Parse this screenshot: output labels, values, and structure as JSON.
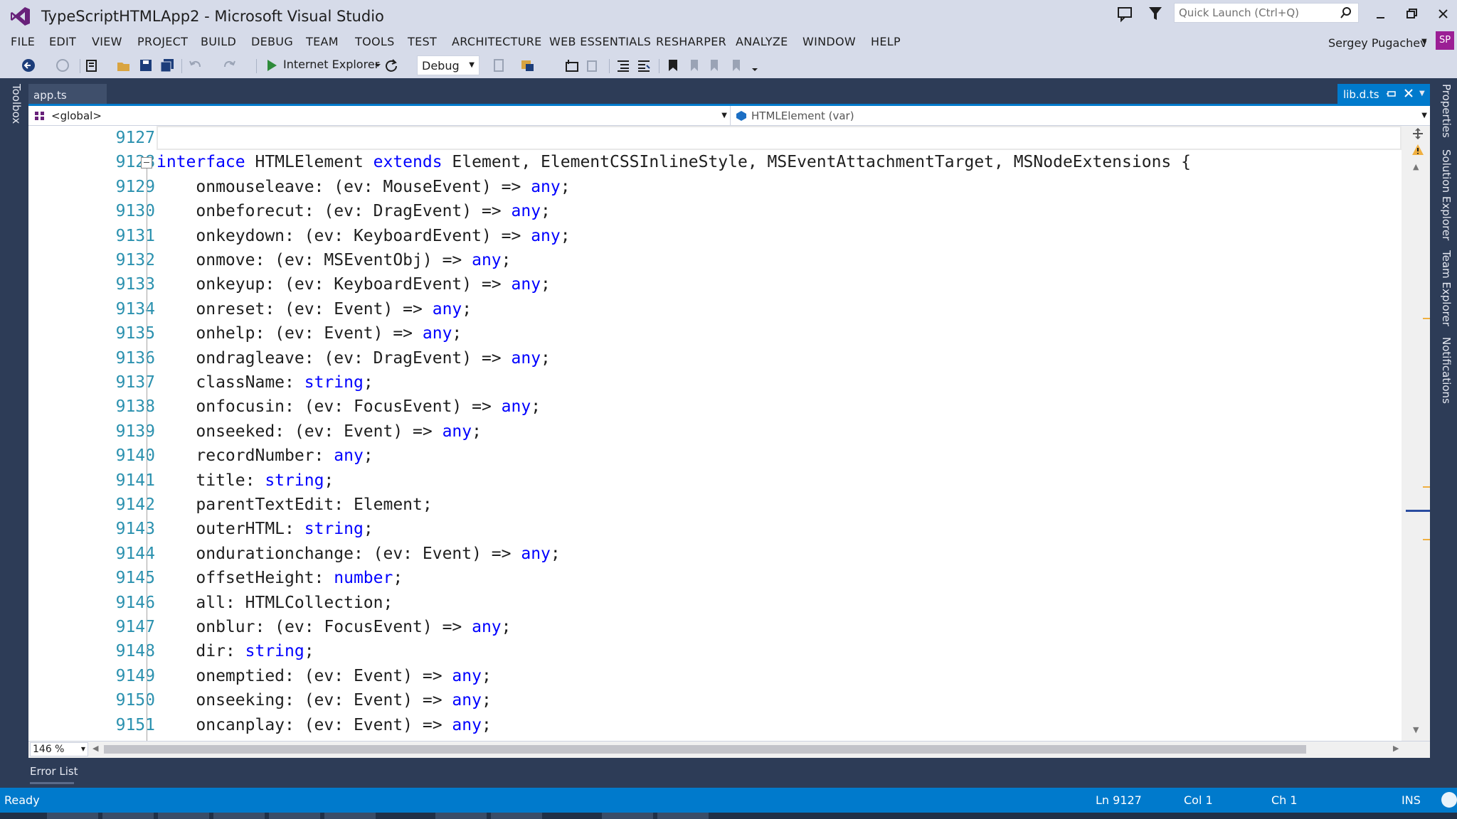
{
  "window": {
    "title": "TypeScriptHTMLApp2 - Microsoft Visual Studio"
  },
  "quick_launch": {
    "placeholder": "Quick Launch (Ctrl+Q)"
  },
  "menu": [
    "FILE",
    "EDIT",
    "VIEW",
    "PROJECT",
    "BUILD",
    "DEBUG",
    "TEAM",
    "TOOLS",
    "TEST",
    "ARCHITECTURE",
    "WEB ESSENTIALS",
    "RESHARPER",
    "ANALYZE",
    "WINDOW",
    "HELP"
  ],
  "user": {
    "name": "Sergey Pugachev",
    "initials": "SP",
    "avatar_color": "#9b1f95"
  },
  "toolbar": {
    "run_target": "Internet Explorer",
    "configuration": "Debug"
  },
  "side_tabs": {
    "left": "Toolbox",
    "right": [
      "Properties",
      "Solution Explorer",
      "Team Explorer",
      "Notifications"
    ]
  },
  "tabs": {
    "left": "app.ts",
    "active": "lib.d.ts"
  },
  "nav": {
    "scope": "<global>",
    "member": "HTMLElement (var)"
  },
  "editor": {
    "zoom": "146 %",
    "lines": [
      {
        "num": "9127",
        "parts": []
      },
      {
        "num": "9128",
        "parts": [
          [
            "kw",
            "interface"
          ],
          [
            "t",
            " HTMLElement "
          ],
          [
            "kw",
            "extends"
          ],
          [
            "t",
            " Element, ElementCSSInlineStyle, MSEventAttachmentTarget, MSNodeExtensions {"
          ]
        ]
      },
      {
        "num": "9129",
        "parts": [
          [
            "t",
            "    onmouseleave: (ev: MouseEvent) => "
          ],
          [
            "kw",
            "any"
          ],
          [
            "t",
            ";"
          ]
        ]
      },
      {
        "num": "9130",
        "parts": [
          [
            "t",
            "    onbeforecut: (ev: DragEvent) => "
          ],
          [
            "kw",
            "any"
          ],
          [
            "t",
            ";"
          ]
        ]
      },
      {
        "num": "9131",
        "parts": [
          [
            "t",
            "    onkeydown: (ev: KeyboardEvent) => "
          ],
          [
            "kw",
            "any"
          ],
          [
            "t",
            ";"
          ]
        ]
      },
      {
        "num": "9132",
        "parts": [
          [
            "t",
            "    onmove: (ev: MSEventObj) => "
          ],
          [
            "kw",
            "any"
          ],
          [
            "t",
            ";"
          ]
        ]
      },
      {
        "num": "9133",
        "parts": [
          [
            "t",
            "    onkeyup: (ev: KeyboardEvent) => "
          ],
          [
            "kw",
            "any"
          ],
          [
            "t",
            ";"
          ]
        ]
      },
      {
        "num": "9134",
        "parts": [
          [
            "t",
            "    onreset: (ev: Event) => "
          ],
          [
            "kw",
            "any"
          ],
          [
            "t",
            ";"
          ]
        ]
      },
      {
        "num": "9135",
        "parts": [
          [
            "t",
            "    onhelp: (ev: Event) => "
          ],
          [
            "kw",
            "any"
          ],
          [
            "t",
            ";"
          ]
        ]
      },
      {
        "num": "9136",
        "parts": [
          [
            "t",
            "    ondragleave: (ev: DragEvent) => "
          ],
          [
            "kw",
            "any"
          ],
          [
            "t",
            ";"
          ]
        ]
      },
      {
        "num": "9137",
        "parts": [
          [
            "t",
            "    className: "
          ],
          [
            "kw",
            "string"
          ],
          [
            "t",
            ";"
          ]
        ]
      },
      {
        "num": "9138",
        "parts": [
          [
            "t",
            "    onfocusin: (ev: FocusEvent) => "
          ],
          [
            "kw",
            "any"
          ],
          [
            "t",
            ";"
          ]
        ]
      },
      {
        "num": "9139",
        "parts": [
          [
            "t",
            "    onseeked: (ev: Event) => "
          ],
          [
            "kw",
            "any"
          ],
          [
            "t",
            ";"
          ]
        ]
      },
      {
        "num": "9140",
        "parts": [
          [
            "t",
            "    recordNumber: "
          ],
          [
            "kw",
            "any"
          ],
          [
            "t",
            ";"
          ]
        ]
      },
      {
        "num": "9141",
        "parts": [
          [
            "t",
            "    title: "
          ],
          [
            "kw",
            "string"
          ],
          [
            "t",
            ";"
          ]
        ]
      },
      {
        "num": "9142",
        "parts": [
          [
            "t",
            "    parentTextEdit: Element;"
          ]
        ]
      },
      {
        "num": "9143",
        "parts": [
          [
            "t",
            "    outerHTML: "
          ],
          [
            "kw",
            "string"
          ],
          [
            "t",
            ";"
          ]
        ]
      },
      {
        "num": "9144",
        "parts": [
          [
            "t",
            "    ondurationchange: (ev: Event) => "
          ],
          [
            "kw",
            "any"
          ],
          [
            "t",
            ";"
          ]
        ]
      },
      {
        "num": "9145",
        "parts": [
          [
            "t",
            "    offsetHeight: "
          ],
          [
            "kw",
            "number"
          ],
          [
            "t",
            ";"
          ]
        ]
      },
      {
        "num": "9146",
        "parts": [
          [
            "t",
            "    all: HTMLCollection;"
          ]
        ]
      },
      {
        "num": "9147",
        "parts": [
          [
            "t",
            "    onblur: (ev: FocusEvent) => "
          ],
          [
            "kw",
            "any"
          ],
          [
            "t",
            ";"
          ]
        ]
      },
      {
        "num": "9148",
        "parts": [
          [
            "t",
            "    dir: "
          ],
          [
            "kw",
            "string"
          ],
          [
            "t",
            ";"
          ]
        ]
      },
      {
        "num": "9149",
        "parts": [
          [
            "t",
            "    onemptied: (ev: Event) => "
          ],
          [
            "kw",
            "any"
          ],
          [
            "t",
            ";"
          ]
        ]
      },
      {
        "num": "9150",
        "parts": [
          [
            "t",
            "    onseeking: (ev: Event) => "
          ],
          [
            "kw",
            "any"
          ],
          [
            "t",
            ";"
          ]
        ]
      },
      {
        "num": "9151",
        "parts": [
          [
            "t",
            "    oncanplay: (ev: Event) => "
          ],
          [
            "kw",
            "any"
          ],
          [
            "t",
            ";"
          ]
        ]
      }
    ]
  },
  "bottom_panel": {
    "tab": "Error List"
  },
  "status": {
    "state": "Ready",
    "line": "Ln 9127",
    "col": "Col 1",
    "ch": "Ch 1",
    "mode": "INS"
  },
  "colors": {
    "accent": "#007acc",
    "keyword": "#0000ff",
    "line_number": "#2b91af",
    "chrome": "#d6dbe9"
  }
}
